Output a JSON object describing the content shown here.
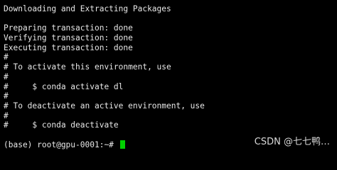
{
  "terminal": {
    "lines": [
      "Downloading and Extracting Packages",
      "",
      "Preparing transaction: done",
      "Verifying transaction: done",
      "Executing transaction: done",
      "#",
      "# To activate this environment, use",
      "#",
      "#     $ conda activate dl",
      "#",
      "# To deactivate an active environment, use",
      "#",
      "#     $ conda deactivate",
      "",
      "(base) root@gpu-0001:~# "
    ],
    "cursor_color": "#00d000",
    "text_color": "#e8e8e8",
    "background_color": "#000000"
  },
  "watermark": {
    "text": "CSDN @七七鸭…"
  }
}
